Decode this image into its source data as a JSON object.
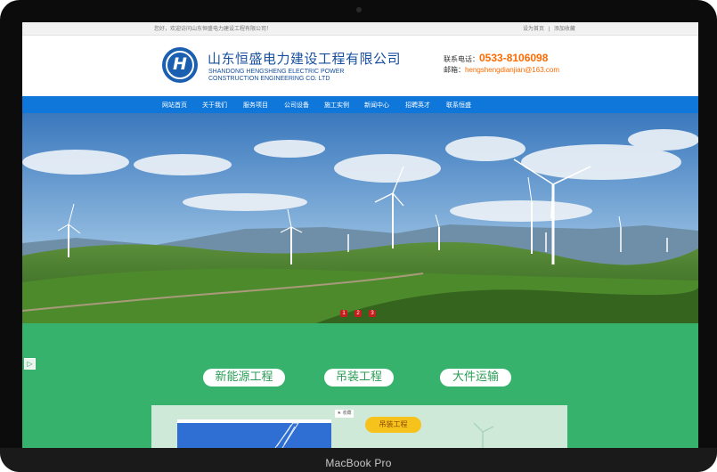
{
  "device": {
    "label": "MacBook Pro"
  },
  "topbar": {
    "welcome": "您好，欢迎访问山东恒盛电力建设工程有限公司！",
    "links": [
      "设为首页",
      "添加收藏"
    ]
  },
  "header": {
    "logo_mark": "H",
    "company_name": "山东恒盛电力建设工程有限公司",
    "english_name_line1": "SHANDONG HENGSHENG ELECTRIC POWER",
    "english_name_line2": "CONSTRUCTION ENGINEERING CO. LTD",
    "phone_label": "联系电话：",
    "phone": "0533-8106098",
    "email_label": "邮箱：",
    "email": "hengshengdianjian@163.com"
  },
  "nav": {
    "items": [
      "网站首页",
      "关于我们",
      "服务项目",
      "公司设备",
      "施工实例",
      "新闻中心",
      "招聘英才",
      "联系恒盛"
    ]
  },
  "banner": {
    "pages": [
      "1",
      "2",
      "3"
    ],
    "active_page": 1
  },
  "services": {
    "items": [
      "新能源工程",
      "吊装工程",
      "大件运输"
    ],
    "side_arrow": "▷",
    "panel_tag": "★ 收藏",
    "panel_button": "吊装工程"
  },
  "colors": {
    "nav_blue": "#0f77d9",
    "brand_blue": "#174f9e",
    "accent_orange": "#ff6a00",
    "section_green": "#37b26c",
    "slide_active": "#c71d1d"
  }
}
